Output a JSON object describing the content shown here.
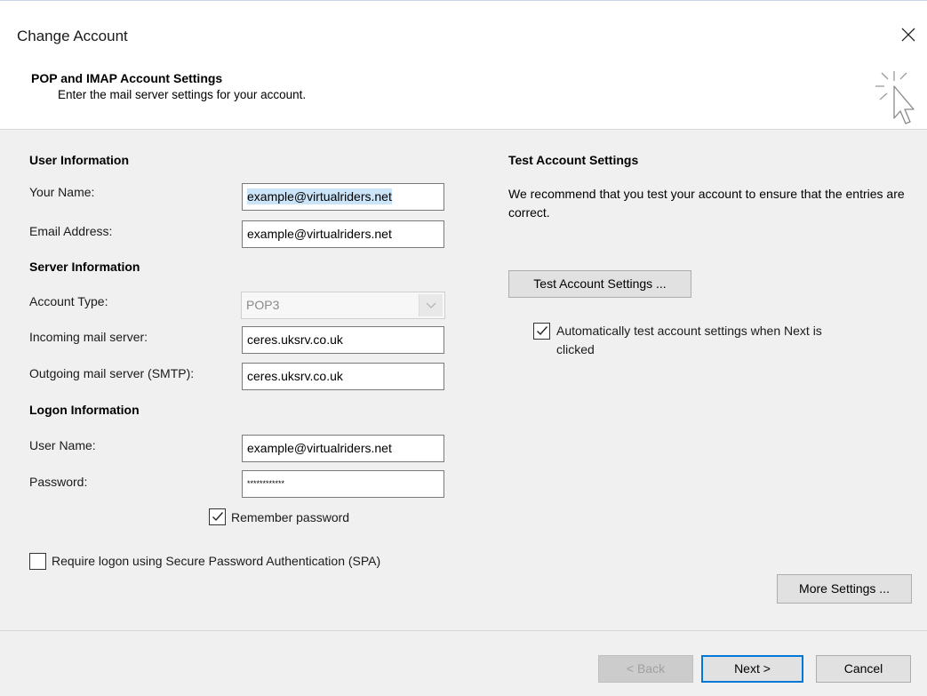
{
  "window": {
    "title": "Change Account"
  },
  "header": {
    "title": "POP and IMAP Account Settings",
    "subtitle": "Enter the mail server settings for your account."
  },
  "user_info": {
    "section_title": "User Information",
    "your_name_label": "Your Name:",
    "your_name_value": "example@virtualriders.net",
    "email_label": "Email Address:",
    "email_value": "example@virtualriders.net"
  },
  "server_info": {
    "section_title": "Server Information",
    "account_type_label": "Account Type:",
    "account_type_value": "POP3",
    "incoming_label": "Incoming mail server:",
    "incoming_value": "ceres.uksrv.co.uk",
    "outgoing_label": "Outgoing mail server (SMTP):",
    "outgoing_value": "ceres.uksrv.co.uk"
  },
  "logon_info": {
    "section_title": "Logon Information",
    "username_label": "User Name:",
    "username_value": "example@virtualriders.net",
    "password_label": "Password:",
    "password_value": "************",
    "remember_label": "Remember password",
    "remember_checked": true,
    "spa_label": "Require logon using Secure Password Authentication (SPA)",
    "spa_checked": false
  },
  "test_settings": {
    "section_title": "Test Account Settings",
    "description": "We recommend that you test your account to ensure that the entries are correct.",
    "test_button": "Test Account Settings ...",
    "auto_test_label_line1": "Automatically test account settings when Next is",
    "auto_test_label_line2": "clicked",
    "auto_test_checked": true
  },
  "more_settings_button": "More Settings ...",
  "footer": {
    "back_button": "< Back",
    "next_button": "Next >",
    "cancel_button": "Cancel"
  },
  "colors": {
    "accent": "#0078d7",
    "selection": "#cce4f7",
    "panel_bg": "#f0f0f0"
  }
}
